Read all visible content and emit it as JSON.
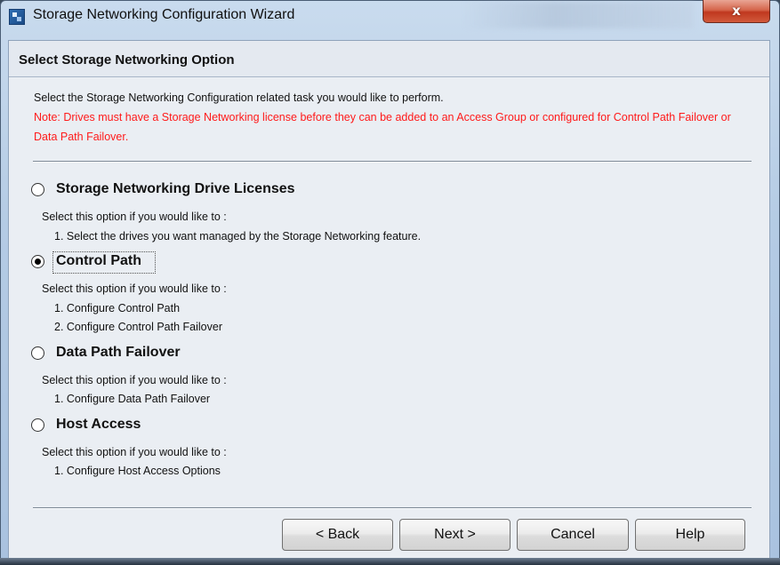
{
  "window": {
    "title": "Storage Networking Configuration Wizard",
    "close_label": "x"
  },
  "header": {
    "title": "Select Storage Networking Option"
  },
  "intro": {
    "description": "Select the Storage Networking Configuration related task you would like to perform.",
    "note": "Note: Drives must have a Storage Networking license before they can be added to an Access Group or configured for Control Path Failover or Data Path Failover."
  },
  "options": [
    {
      "label": "Storage Networking Drive Licenses",
      "selected": false,
      "prompt": "Select this option if you would like to :",
      "items": [
        "1. Select the drives you want managed by the Storage Networking feature."
      ]
    },
    {
      "label": "Control Path",
      "selected": true,
      "prompt": "Select this option if you would like to :",
      "items": [
        "1. Configure Control Path",
        "2. Configure Control Path Failover"
      ]
    },
    {
      "label": "Data Path Failover",
      "selected": false,
      "prompt": "Select this option if you would like to :",
      "items": [
        "1. Configure Data Path Failover"
      ]
    },
    {
      "label": "Host Access",
      "selected": false,
      "prompt": "Select this option if you would like to :",
      "items": [
        "1. Configure Host Access Options"
      ]
    }
  ],
  "buttons": {
    "back": "< Back",
    "next": "Next >",
    "cancel": "Cancel",
    "help": "Help"
  },
  "colors": {
    "note_text": "#ff1a1a",
    "close_button": "#c0381f",
    "dialog_background": "#eaeef3"
  }
}
